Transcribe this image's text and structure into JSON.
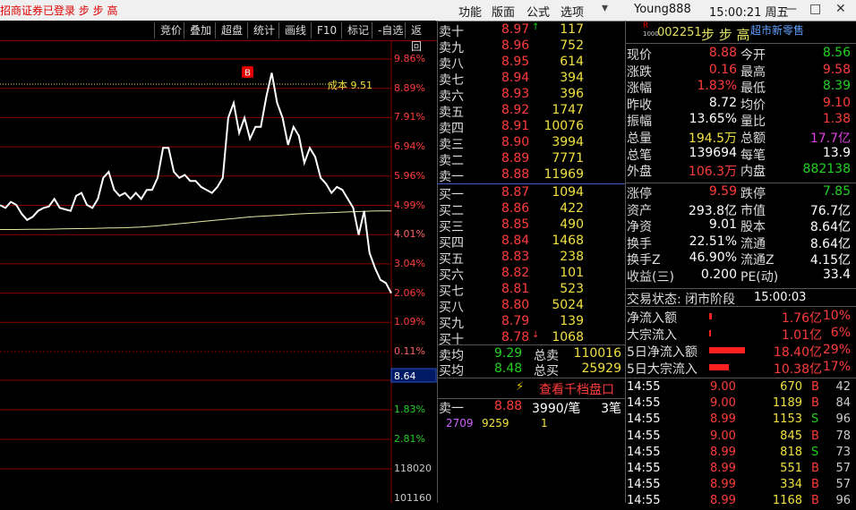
{
  "topbar": {
    "broker": "招商证券已登录  步 步 高",
    "menus": [
      "功能",
      "版面",
      "公式",
      "选项"
    ],
    "user": "Young888",
    "clock": "15:00:21 周五",
    "min": "—",
    "max": "□",
    "close": "✕"
  },
  "toolbar": [
    "竞价",
    "叠加",
    "超盘",
    "统计",
    "画线",
    "F10",
    "标记",
    "-自选",
    "返回"
  ],
  "chart": {
    "cost_label": "成本 9.51",
    "b_marker": "B",
    "current_price_tag": "8.64",
    "y_labels_up": [
      "9.86%",
      "8.89%",
      "7.91%",
      "6.94%",
      "5.96%",
      "4.99%",
      "4.01%",
      "3.04%",
      "2.06%",
      "1.09%",
      "0.11%"
    ],
    "y_labels_down": [
      "1.83%",
      "2.81%"
    ],
    "vol_labels": [
      "118020",
      "101160"
    ],
    "price_series": [
      4.99,
      4.9,
      5.1,
      5.0,
      4.7,
      4.5,
      4.6,
      4.8,
      4.9,
      4.95,
      5.2,
      4.9,
      4.85,
      4.8,
      5.3,
      5.4,
      5.0,
      4.9,
      5.2,
      5.9,
      6.1,
      5.5,
      5.3,
      5.4,
      5.2,
      5.4,
      5.2,
      5.5,
      5.5,
      5.9,
      6.9,
      6.9,
      6.1,
      5.9,
      6.0,
      5.8,
      5.8,
      5.6,
      5.5,
      5.4,
      5.6,
      5.9,
      7.9,
      8.4,
      7.4,
      7.9,
      7.2,
      7.6,
      7.6,
      8.6,
      9.4,
      8.4,
      7.9,
      7.0,
      7.6,
      7.3,
      6.4,
      6.9,
      6.6,
      5.9,
      5.7,
      5.4,
      5.6,
      5.5,
      5.2,
      4.9,
      4.0,
      4.8,
      3.4,
      2.9,
      2.5,
      2.4,
      2.06
    ],
    "avg_series": [
      4.18,
      4.18,
      4.19,
      4.19,
      4.2,
      4.21,
      4.22,
      4.23,
      4.24,
      4.26,
      4.3,
      4.35,
      4.4,
      4.45,
      4.5,
      4.55,
      4.6,
      4.63,
      4.66,
      4.7,
      4.72,
      4.74,
      4.76,
      4.78,
      4.8,
      4.8
    ]
  },
  "orderbook": {
    "sell": [
      {
        "label": "卖十",
        "price": "8.97",
        "vol": "117",
        "arrow": "↑"
      },
      {
        "label": "卖九",
        "price": "8.96",
        "vol": "752"
      },
      {
        "label": "卖八",
        "price": "8.95",
        "vol": "614"
      },
      {
        "label": "卖七",
        "price": "8.94",
        "vol": "394"
      },
      {
        "label": "卖六",
        "price": "8.93",
        "vol": "396"
      },
      {
        "label": "卖五",
        "price": "8.92",
        "vol": "1747"
      },
      {
        "label": "卖四",
        "price": "8.91",
        "vol": "10076"
      },
      {
        "label": "卖三",
        "price": "8.90",
        "vol": "3994"
      },
      {
        "label": "卖二",
        "price": "8.89",
        "vol": "7771"
      },
      {
        "label": "卖一",
        "price": "8.88",
        "vol": "11969"
      }
    ],
    "buy": [
      {
        "label": "买一",
        "price": "8.87",
        "vol": "1094"
      },
      {
        "label": "买二",
        "price": "8.86",
        "vol": "422"
      },
      {
        "label": "买三",
        "price": "8.85",
        "vol": "490"
      },
      {
        "label": "买四",
        "price": "8.84",
        "vol": "1468"
      },
      {
        "label": "买五",
        "price": "8.83",
        "vol": "238"
      },
      {
        "label": "买六",
        "price": "8.82",
        "vol": "101"
      },
      {
        "label": "买七",
        "price": "8.81",
        "vol": "523"
      },
      {
        "label": "买八",
        "price": "8.80",
        "vol": "5024"
      },
      {
        "label": "买九",
        "price": "8.79",
        "vol": "139"
      },
      {
        "label": "买十",
        "price": "8.78",
        "vol": "1068",
        "arrow": "↓"
      }
    ],
    "avg_sell_label": "卖均",
    "avg_sell": "9.29",
    "total_sell_label": "总卖",
    "total_sell": "110016",
    "avg_buy_label": "买均",
    "avg_buy": "8.48",
    "total_buy_label": "总买",
    "total_buy": "25929",
    "view_depth": "查看千档盘口",
    "queue_label": "卖一",
    "queue_price": "8.88",
    "queue_vol": "3990/笔",
    "queue_count": "3笔",
    "queue_items": [
      "2709",
      "9259",
      "1"
    ]
  },
  "info": {
    "code_prefix": "R",
    "code_sub": "1000",
    "code": "002251",
    "name": "步 步 高",
    "sector": "超市新零售",
    "rows": [
      {
        "l1": "现价",
        "v1": "8.88",
        "c1": "red",
        "l2": "今开",
        "v2": "8.56",
        "c2": "green"
      },
      {
        "l1": "涨跌",
        "v1": "0.16",
        "c1": "red",
        "l2": "最高",
        "v2": "9.58",
        "c2": "red"
      },
      {
        "l1": "涨幅",
        "v1": "1.83%",
        "c1": "red",
        "l2": "最低",
        "v2": "8.39",
        "c2": "green"
      },
      {
        "l1": "昨收",
        "v1": "8.72",
        "c1": "white",
        "l2": "均价",
        "v2": "9.10",
        "c2": "red"
      },
      {
        "l1": "振幅",
        "v1": "13.65%",
        "c1": "white",
        "l2": "量比",
        "v2": "1.38",
        "c2": "red"
      },
      {
        "l1": "总量",
        "v1": "194.5万",
        "c1": "yellow",
        "l2": "总额",
        "v2": "17.7亿",
        "c2": "magenta"
      },
      {
        "l1": "总笔",
        "v1": "139694",
        "c1": "white",
        "l2": "每笔",
        "v2": "13.9",
        "c2": "white"
      },
      {
        "l1": "外盘",
        "v1": "106.3万",
        "c1": "red",
        "l2": "内盘",
        "v2": "882138",
        "c2": "green"
      }
    ],
    "rows2": [
      {
        "l1": "涨停",
        "v1": "9.59",
        "c1": "red",
        "l2": "跌停",
        "v2": "7.85",
        "c2": "green"
      },
      {
        "l1": "资产",
        "v1": "293.8亿",
        "c1": "white",
        "l2": "市值",
        "v2": "76.7亿",
        "c2": "white"
      },
      {
        "l1": "净资",
        "v1": "9.01",
        "c1": "white",
        "l2": "股本",
        "v2": "8.64亿",
        "c2": "white"
      },
      {
        "l1": "换手",
        "v1": "22.51%",
        "c1": "white",
        "l2": "流通",
        "v2": "8.64亿",
        "c2": "white"
      },
      {
        "l1": "换手Z",
        "v1": "46.90%",
        "c1": "white",
        "l2": "流通Z",
        "v2": "4.15亿",
        "c2": "white"
      },
      {
        "l1": "收益(三)",
        "v1": "0.200",
        "c1": "white",
        "l2": "PE(动)",
        "v2": "33.4",
        "c2": "white"
      }
    ],
    "trade_status_label": "交易状态: 闭市阶段",
    "trade_status_time": "15:00:03",
    "flows": [
      {
        "label": "净流入额",
        "value": "1.76亿",
        "pct": "10%",
        "bar": 0.06
      },
      {
        "label": "大宗流入",
        "value": "1.01亿",
        "pct": "6%",
        "bar": 0.03
      },
      {
        "label": "5日净流入额",
        "value": "18.40亿",
        "pct": "29%",
        "bar": 0.9
      },
      {
        "label": "5日大宗流入",
        "value": "10.38亿",
        "pct": "17%",
        "bar": 0.5
      }
    ],
    "ticks": [
      {
        "time": "14:55",
        "price": "9.00",
        "vol": "670",
        "side": "B",
        "n": "42"
      },
      {
        "time": "14:55",
        "price": "9.00",
        "vol": "1189",
        "side": "B",
        "n": "84"
      },
      {
        "time": "14:55",
        "price": "8.99",
        "vol": "1153",
        "side": "S",
        "n": "96"
      },
      {
        "time": "14:55",
        "price": "9.00",
        "vol": "845",
        "side": "B",
        "n": "78"
      },
      {
        "time": "14:55",
        "price": "8.99",
        "vol": "818",
        "side": "S",
        "n": "73"
      },
      {
        "time": "14:55",
        "price": "8.99",
        "vol": "551",
        "side": "B",
        "n": "57"
      },
      {
        "time": "14:55",
        "price": "8.99",
        "vol": "334",
        "side": "B",
        "n": "57"
      },
      {
        "time": "14:55",
        "price": "8.99",
        "vol": "1168",
        "side": "B",
        "n": "96"
      }
    ]
  }
}
